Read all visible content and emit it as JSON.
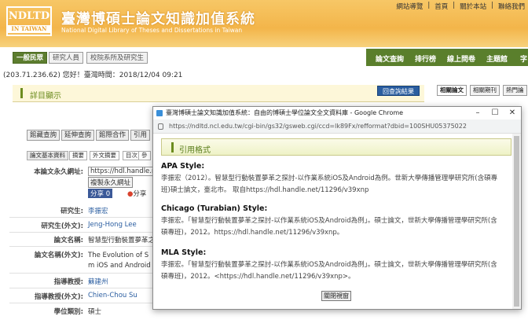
{
  "header": {
    "logo_main": "NDLTD",
    "logo_sub": "IN TAIWAN",
    "title": "臺灣博碩士論文知識加值系統",
    "subtitle": "National Digital Library of Theses and Dissertations in Taiwan",
    "links": [
      "網站導覽",
      "首頁",
      "關於本站",
      "聯絡我們"
    ]
  },
  "nav": {
    "modes": [
      "一般民眾",
      "研究人員",
      "校院系所及研究生"
    ],
    "main": [
      "論文查詢",
      "排行榜",
      "線上問卷",
      "主題館"
    ],
    "overflow": "字"
  },
  "visitor": "(203.71.236.62) 您好！臺灣時間：2018/12/04 09:21",
  "detail": {
    "title": "詳目顯示",
    "back": "回查詢結果",
    "tabs": [
      "館藏查詢",
      "延伸查詢",
      "館際合作",
      "引用"
    ],
    "subtabs": [
      "論文基本資料",
      "摘要",
      "外文摘要",
      "目次",
      "參"
    ],
    "fields": [
      {
        "label": "本論文永久網址:",
        "value": "https://hdl.handle.net"
      },
      {
        "label": "研究生:",
        "value": "李振宏"
      },
      {
        "label": "研究生(外文):",
        "value": "Jeng-Hong Lee"
      },
      {
        "label": "論文名稱:",
        "value": "智慧型行動裝置夢革之"
      },
      {
        "label": "論文名稱(外文):",
        "value": "The Evolution of S"
      },
      {
        "label": "指導教授:",
        "value": "蘇建州"
      },
      {
        "label": "指導教授(外文):",
        "value": "Chien-Chou Su"
      },
      {
        "label": "學位類別:",
        "value": "碩士"
      }
    ],
    "title_en_line2": "m iOS and Android",
    "copy_btn": "複製永久網址",
    "fb_label": "分享 0",
    "share": "分享"
  },
  "right_tabs": [
    "相關論文",
    "相關期刊",
    "熱門論"
  ],
  "popup": {
    "window_title": "臺灣博碩士論文知識加值系統：自由的博碩士學位論文全文資料庫 - Google Chrome",
    "url": "https://ndltd.ncl.edu.tw/cgi-bin/gs32/gsweb.cgi/ccd=lk89Fx/refformat?dbid=100SHU05375022",
    "heading": "引用格式",
    "styles": [
      {
        "name": "APA Style:",
        "lines": [
          "李振宏（2012）。智慧型行動裝置夢革之探討-以作業系統iOS及Android為例。世新大學傳播管理學研究所(含碩專",
          "班)碩士論文，臺北市。 取自https://hdl.handle.net/11296/v39xnp"
        ]
      },
      {
        "name": "Chicago (Turabian) Style:",
        "lines": [
          "李振宏。「智慧型行動裝置夢革之探討-以作業系統iOS及Android為例」。碩士論文，世新大學傳播管理學研究所(含",
          "碩專班)，2012。https://hdl.handle.net/11296/v39xnp。"
        ]
      },
      {
        "name": "MLA Style:",
        "lines": [
          "李振宏。「智慧型行動裝置夢革之探討-以作業系統iOS及Android為例」。碩士論文，世新大學傳播管理學研究所(含",
          "碩專班)，2012。<https://hdl.handle.net/11296/v39xnp>。"
        ]
      }
    ],
    "close": "關閉視窗"
  }
}
